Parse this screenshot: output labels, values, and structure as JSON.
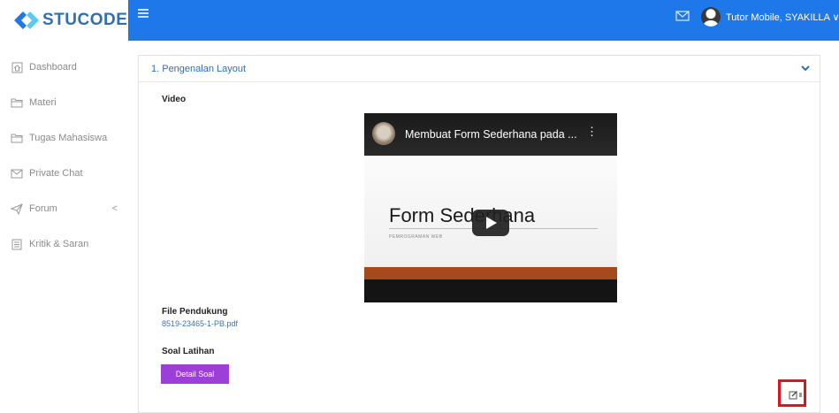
{
  "brand": {
    "name": "STUCODE",
    "color": "#2f6fb5"
  },
  "sidebar": {
    "items": [
      {
        "label": "Dashboard",
        "icon": "home-icon"
      },
      {
        "label": "Materi",
        "icon": "folder-icon"
      },
      {
        "label": "Tugas Mahasiswa",
        "icon": "folder-icon"
      },
      {
        "label": "Private Chat",
        "icon": "envelope-icon"
      },
      {
        "label": "Forum",
        "icon": "paper-plane-icon",
        "caret": "<"
      },
      {
        "label": "Kritik & Saran",
        "icon": "document-icon"
      }
    ]
  },
  "topbar": {
    "color": "#1e78ea",
    "user_name": "Tutor Mobile, SYAKILLA ∨"
  },
  "card": {
    "title": "1. Pengenalan Layout",
    "video_label": "Video",
    "file_label": "File Pendukung",
    "file_name": "8519-23465-1-PB.pdf",
    "soal_label": "Soal Latihan",
    "detail_button": "Detail Soal",
    "button_color": "#9b3fd6"
  },
  "video": {
    "title": "Membuat Form Sederhana pada ...",
    "menu": "⋮",
    "slide_title": "Form Sederhana",
    "slide_subtitle": "PEMROGRAMAN WEB"
  }
}
